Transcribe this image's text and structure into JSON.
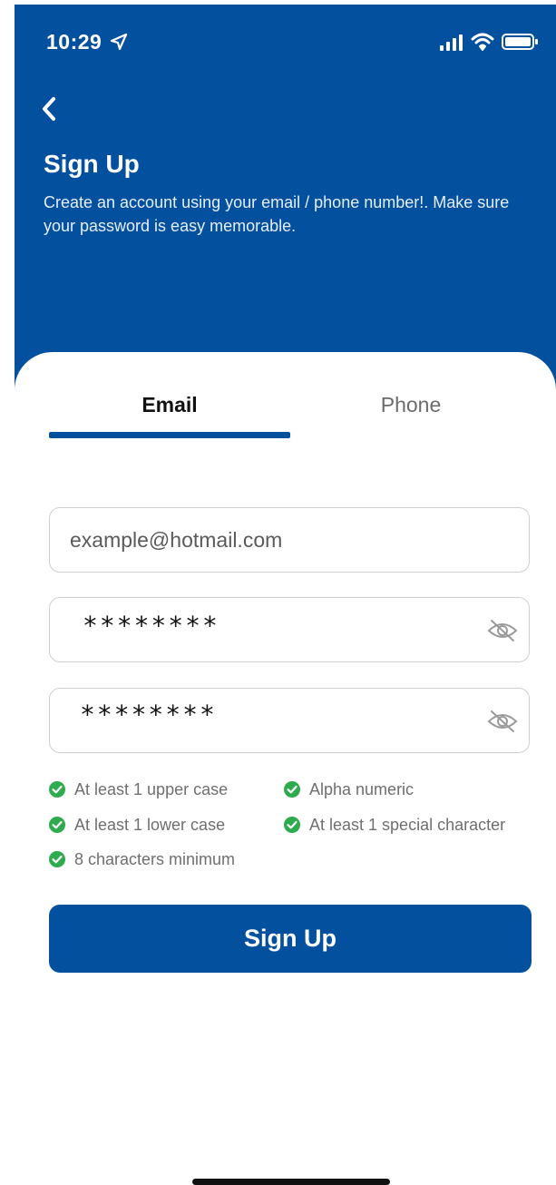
{
  "status_bar": {
    "time": "10:29",
    "icons": [
      "location-arrow-icon",
      "cellular-signal-icon",
      "wifi-icon",
      "battery-icon"
    ]
  },
  "header": {
    "back_icon": "chevron-left-icon",
    "title": "Sign Up",
    "subtitle": "Create an account using your email / phone number!. Make sure your password is easy memorable."
  },
  "tabs": [
    {
      "label": "Email",
      "selected": true
    },
    {
      "label": "Phone",
      "selected": false
    }
  ],
  "form": {
    "email": {
      "placeholder": "example@hotmail.com",
      "value": ""
    },
    "password": {
      "masked_value": "********",
      "toggle_icon": "eye-slash-icon"
    },
    "confirm_password": {
      "masked_value": "********",
      "toggle_icon": "eye-slash-icon"
    }
  },
  "password_rules": [
    {
      "label": "At least 1 upper case",
      "met": true
    },
    {
      "label": "Alpha numeric",
      "met": true
    },
    {
      "label": "At least 1 lower case",
      "met": true
    },
    {
      "label": "At least 1 special character",
      "met": true
    },
    {
      "label": "8 characters minimum",
      "met": true
    }
  ],
  "submit_label": "Sign Up",
  "colors": {
    "brand": "#03509f",
    "check": "#2eaa4f",
    "text_muted": "#6f6f6f",
    "border": "#cfcfcf"
  }
}
